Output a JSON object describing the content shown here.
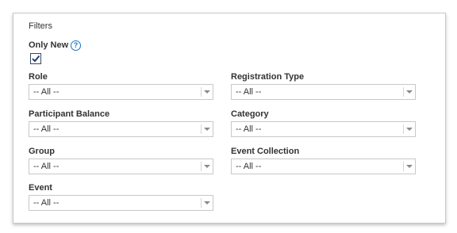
{
  "filters": {
    "title": "Filters",
    "only_new_label": "Only New",
    "only_new_checked": true,
    "help_icon": "question-circle-icon",
    "fields": {
      "role": {
        "label": "Role",
        "value": "-- All --"
      },
      "registration_type": {
        "label": "Registration Type",
        "value": "-- All --"
      },
      "participant_balance": {
        "label": "Participant Balance",
        "value": "-- All --"
      },
      "category": {
        "label": "Category",
        "value": "-- All --"
      },
      "group": {
        "label": "Group",
        "value": "-- All --"
      },
      "event_collection": {
        "label": "Event Collection",
        "value": "-- All --"
      },
      "event": {
        "label": "Event",
        "value": "-- All --"
      }
    }
  },
  "colors": {
    "accent": "#1a73c8",
    "border": "#c8c8c8",
    "text": "#333333"
  }
}
